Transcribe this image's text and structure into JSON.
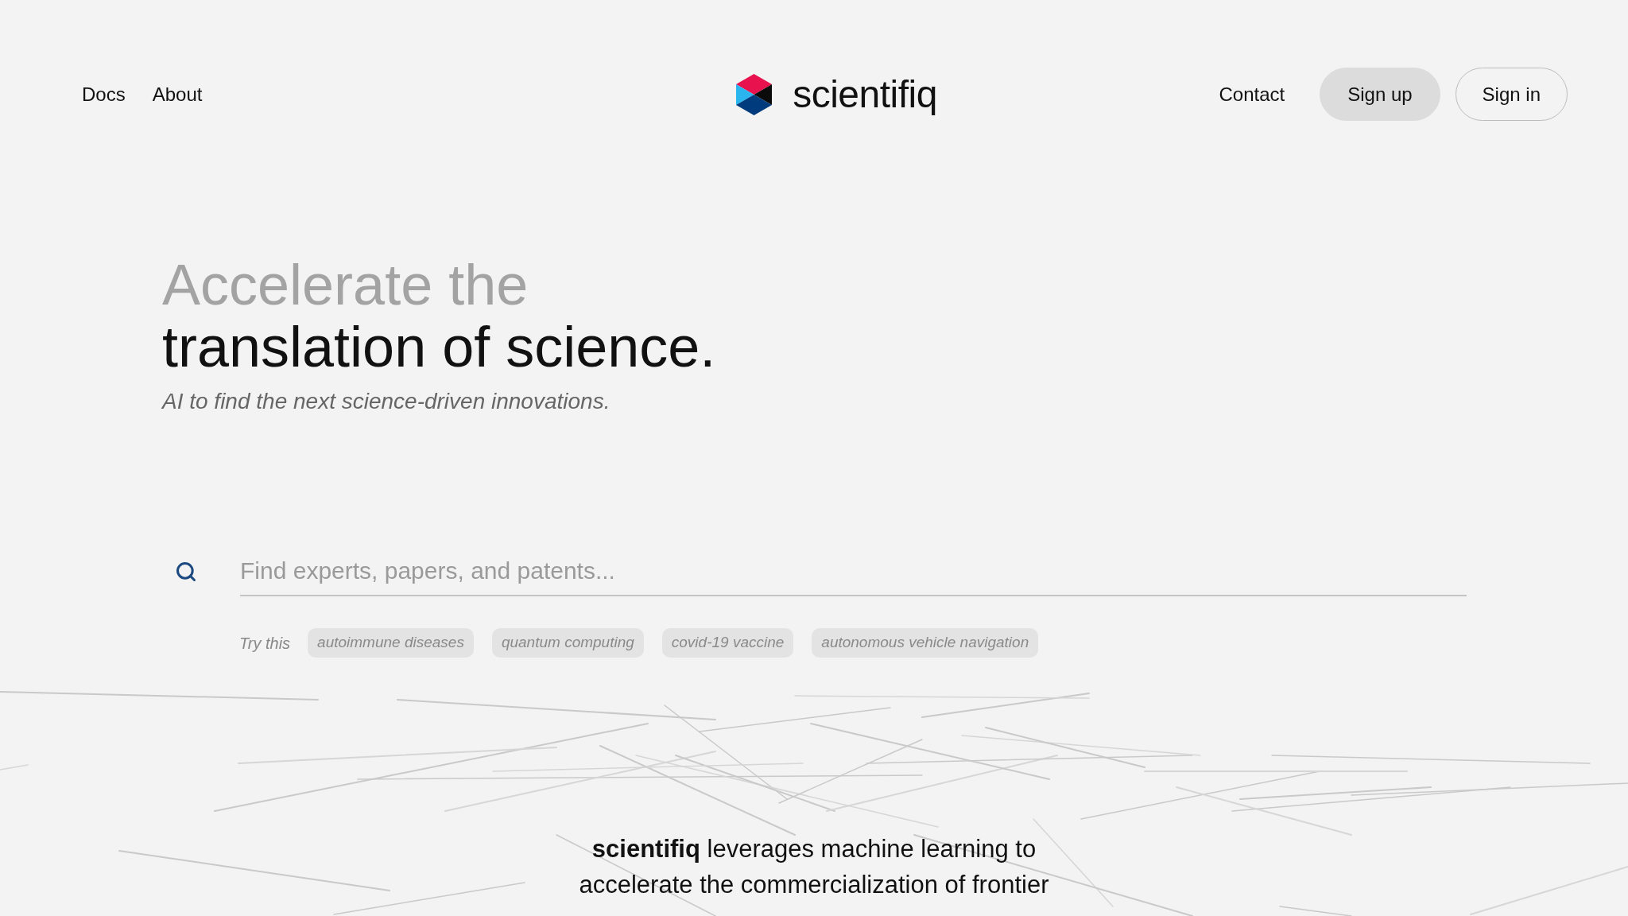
{
  "nav": {
    "left_links": [
      "Docs",
      "About"
    ],
    "logo": {
      "text": "scientifiq"
    },
    "right_links": [
      "Contact"
    ],
    "buttons": [
      {
        "label": "Sign up",
        "kind": "filled"
      },
      {
        "label": "Sign in",
        "kind": "outlined"
      }
    ]
  },
  "hero": {
    "title_light": "Accelerate the",
    "title_bold": "translation of science.",
    "subtitle": "AI to find the next science-driven innovations."
  },
  "search": {
    "placeholder": "Find experts, papers, and patents...",
    "suggestions_label": "Try this",
    "suggestions": [
      "autoimmune diseases",
      "quantum computing",
      "covid-19 vaccine",
      "autonomous vehicle navigation"
    ]
  },
  "about": {
    "text": "**scientifiq** leverages machine learning to accelerate the commercialization of frontier"
  }
}
